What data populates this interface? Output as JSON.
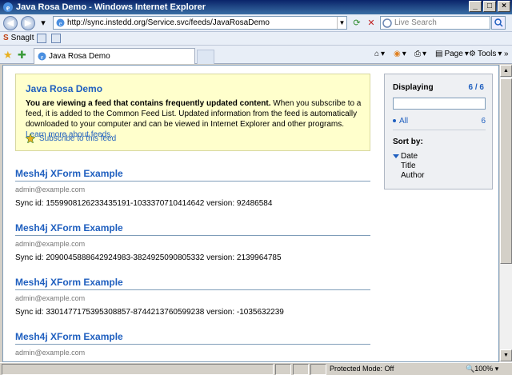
{
  "window": {
    "title": "Java Rosa Demo - Windows Internet Explorer"
  },
  "address": {
    "url": "http://sync.instedd.org/Service.svc/feeds/JavaRosaDemo"
  },
  "search": {
    "placeholder": "Live Search"
  },
  "links_toolbar": {
    "snagit_label": "SnagIt"
  },
  "tabs": [
    {
      "label": "Java Rosa Demo"
    }
  ],
  "commands": {
    "page_label": "Page",
    "tools_label": "Tools"
  },
  "feed_info": {
    "title": "Java Rosa Demo",
    "bold_text": "You are viewing a feed that contains frequently updated content.",
    "body_text": " When you subscribe to a feed, it is added to the Common Feed List. Updated information from the feed is automatically downloaded to your computer and can be viewed in Internet Explorer and other programs. ",
    "learn_more": "Learn more about feeds.",
    "subscribe_label": "Subscribe to this feed"
  },
  "entries": [
    {
      "title": "Mesh4j XForm Example",
      "author": "admin@example.com",
      "body": "Sync id: 15599081262334351​91-1033370710414642 version: 92486584"
    },
    {
      "title": "Mesh4j XForm Example",
      "author": "admin@example.com",
      "body": "Sync id: 2090045888642924983-3824925090805332 version: 2139964785"
    },
    {
      "title": "Mesh4j XForm Example",
      "author": "admin@example.com",
      "body": "Sync id: 3301477175395308857-8744213760599238 version: -1035632239"
    },
    {
      "title": "Mesh4j XForm Example",
      "author": "admin@example.com",
      "body": ""
    }
  ],
  "side_panel": {
    "displaying_label": "Displaying",
    "count": "6 / 6",
    "all_label": "All",
    "all_count": "6",
    "sort_by_label": "Sort by:",
    "sort_options": [
      "Date",
      "Title",
      "Author"
    ]
  },
  "status": {
    "protected_mode": "Protected Mode: Off",
    "zoom": "100%"
  },
  "colors": {
    "link_blue": "#1f5fbf",
    "info_bg": "#ffffcc",
    "title_bar": "#0a246a"
  }
}
